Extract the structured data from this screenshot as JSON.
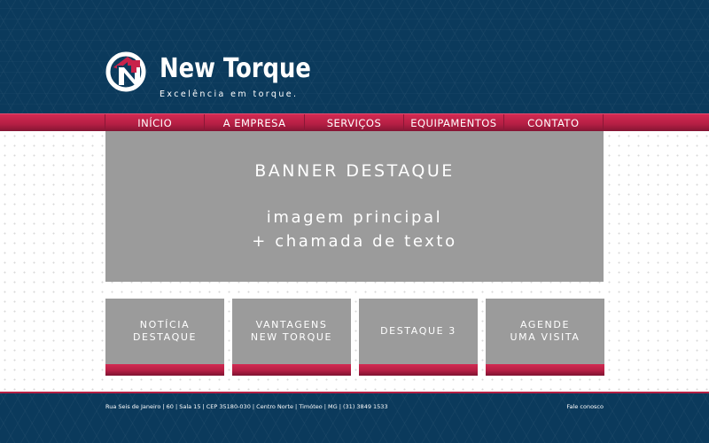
{
  "brand": {
    "name": "New Torque",
    "tagline": "Excelência em torque.",
    "logo_icon": "nt-logo-mark",
    "colors": {
      "navy": "#0b3a5c",
      "red": "#b51f44",
      "gray": "#9b9b9b"
    }
  },
  "nav": {
    "items": [
      {
        "label": "INÍCIO"
      },
      {
        "label": "A EMPRESA"
      },
      {
        "label": "SERVIÇOS"
      },
      {
        "label": "EQUIPAMENTOS"
      },
      {
        "label": "CONTATO"
      }
    ]
  },
  "banner": {
    "title": "BANNER DESTAQUE",
    "subtitle_line1": "imagem principal",
    "subtitle_line2": "+ chamada de texto"
  },
  "boxes": [
    {
      "label": "NOTÍCIA\nDESTAQUE"
    },
    {
      "label": "VANTAGENS\nNEW TORQUE"
    },
    {
      "label": "DESTAQUE 3"
    },
    {
      "label": "AGENDE\nUMA VISITA"
    }
  ],
  "footer": {
    "address": "Rua Seis de Janeiro  |  60  |  Sala 15  |  CEP 35180-030  |  Centro Norte  |  Timóteo  |  MG  |  (31) 3849 1533",
    "contact_link": "Fale conosco"
  }
}
